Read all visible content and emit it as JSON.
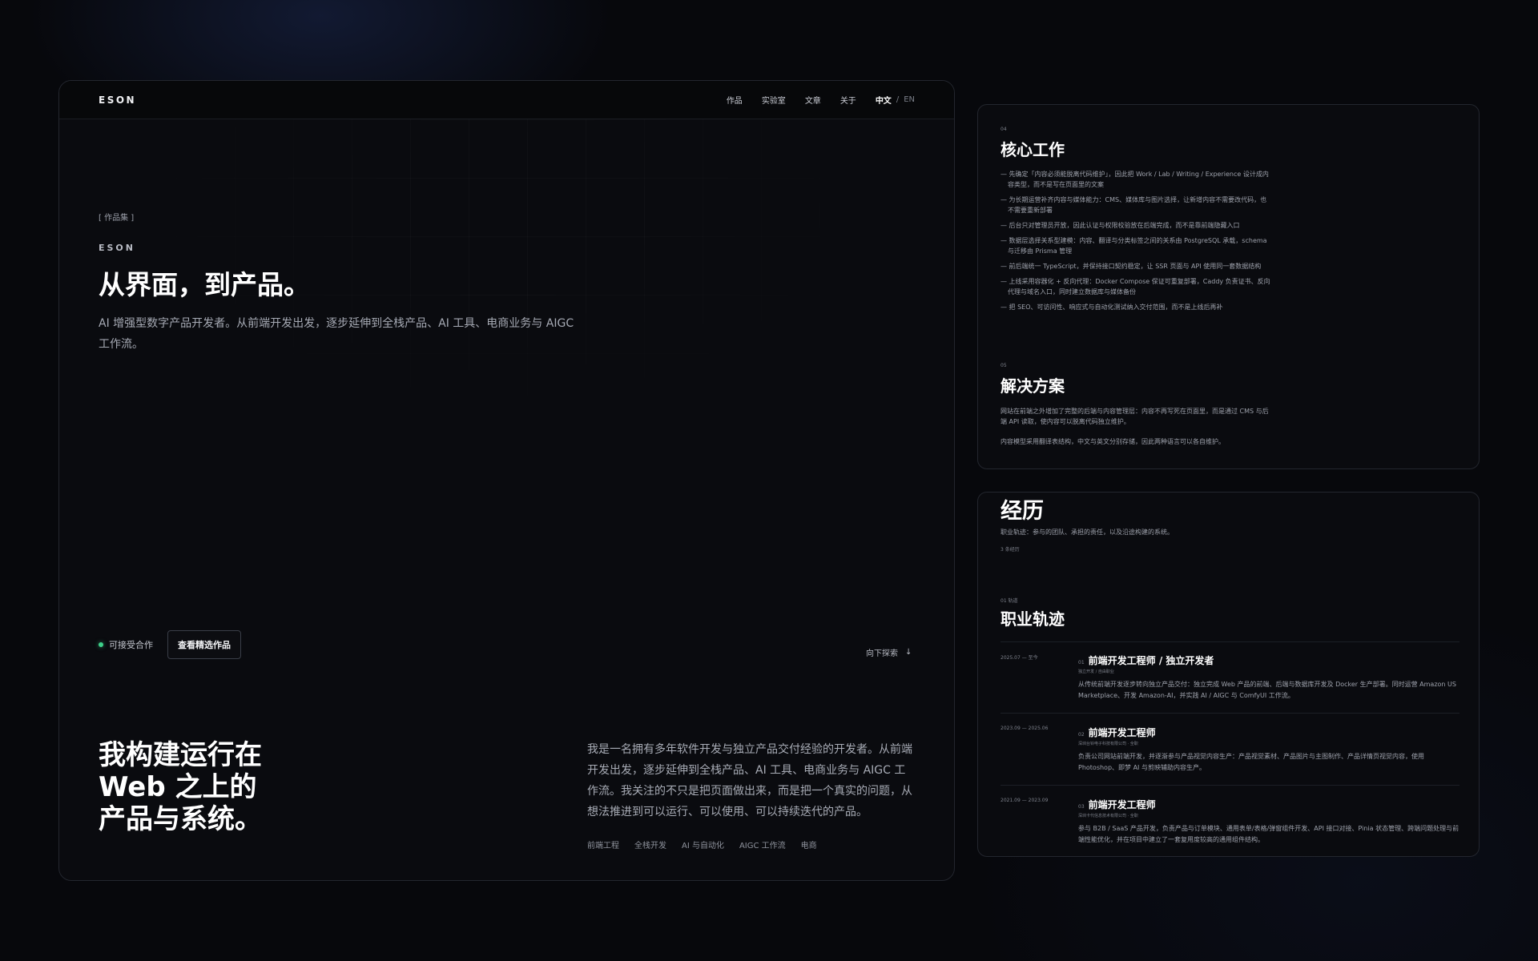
{
  "nav": {
    "logo": "ESON",
    "links": [
      "作品",
      "实验室",
      "文章",
      "关于"
    ],
    "lang_active": "中文",
    "lang_sep": "/",
    "lang_inactive": "EN"
  },
  "hero": {
    "eyebrow": "[ 作品集 ]",
    "brand": "ESON",
    "title": "从界面，到产品。",
    "description": "AI 增强型数字产品开发者。从前端开发出发，逐步延伸到全栈产品、AI 工具、电商业务与 AIGC 工作流。",
    "status": "可接受合作",
    "cta": "查看精选作品",
    "scroll_hint": "向下探索",
    "scroll_arrow": "↓"
  },
  "about": {
    "title_lines": [
      "我构建运行在",
      "Web 之上的",
      "产品与系统。"
    ],
    "description": "我是一名拥有多年软件开发与独立产品交付经验的开发者。从前端开发出发，逐步延伸到全栈产品、AI 工具、电商业务与 AIGC 工作流。我关注的不只是把页面做出来，而是把一个真实的问题，从想法推进到可以运行、可以使用、可以持续迭代的产品。",
    "tags": [
      "前端工程",
      "全栈开发",
      "AI 与自动化",
      "AIGC 工作流",
      "电商"
    ]
  },
  "core": {
    "number": "04",
    "title": "核心工作",
    "items": [
      "— 先确定「内容必须能脱离代码维护」，因此把 Work / Lab / Writing / Experience 设计成内容类型，而不是写在页面里的文案",
      "— 为长期运营补齐内容与媒体能力：CMS、媒体库与图片选择，让新增内容不需要改代码，也不需要重新部署",
      "— 后台只对管理员开放，因此认证与权限校验放在后端完成，而不是靠前端隐藏入口",
      "— 数据层选择关系型建模：内容、翻译与分类标签之间的关系由 PostgreSQL 承载，schema 与迁移由 Prisma 管理",
      "— 前后端统一 TypeScript，并保持接口契约稳定，让 SSR 页面与 API 使用同一套数据结构",
      "— 上线采用容器化 + 反向代理：Docker Compose 保证可重复部署，Caddy 负责证书、反向代理与域名入口，同时建立数据库与媒体备份",
      "— 把 SEO、可访问性、响应式与自动化测试纳入交付范围，而不是上线后再补"
    ]
  },
  "solution": {
    "number": "05",
    "title": "解决方案",
    "paragraphs": [
      "网站在前端之外增加了完整的后端与内容管理层：内容不再写死在页面里，而是通过 CMS 与后端 API 读取，使内容可以脱离代码独立维护。",
      "内容模型采用翻译表结构，中文与英文分别存储，因此两种语言可以各自维护。"
    ]
  },
  "experience": {
    "title": "经历",
    "subtitle": "职业轨迹：参与的团队、承担的责任，以及沿途构建的系统。",
    "count": "3 条经历",
    "track_number": "01 轨道",
    "track_title": "职业轨迹",
    "jobs": [
      {
        "date": "2025.07 — 至今",
        "index": "01",
        "title": "前端开发工程师 / 独立开发者",
        "org": "独立开发 / 自由职业",
        "description": "从传统前端开发逐步转向独立产品交付：独立完成 Web 产品的前端、后端与数据库开发及 Docker 生产部署。同时运营 Amazon US Marketplace、开发 Amazon-AI，并实践 AI / AIGC 与 ComfyUI 工作流。"
      },
      {
        "date": "2023.09 — 2025.06",
        "index": "02",
        "title": "前端开发工程师",
        "org": "深圳台铃电子科技有限公司 · 全职",
        "description": "负责公司网站前端开发，并逐渐参与产品视觉内容生产：产品视觉素材、产品图片与主图制作、产品详情页视觉内容，使用 Photoshop、即梦 AI 与剪映辅助内容生产。"
      },
      {
        "date": "2021.09 — 2023.09",
        "index": "03",
        "title": "前端开发工程师",
        "org": "深圳卡代信息技术有限公司 · 全职",
        "description": "参与 B2B / SaaS 产品开发，负责产品与订单模块、通用表单/表格/弹窗组件开发、API 接口对接、Pinia 状态管理、跨端问题处理与前端性能优化，并在项目中建立了一套复用度较高的通用组件结构。"
      }
    ]
  },
  "colors": {
    "background": "#07080c",
    "card": "#0a0b0f",
    "accent_green": "#3ed18a",
    "text_primary": "#ffffff",
    "text_muted": "#9ea2ac"
  }
}
